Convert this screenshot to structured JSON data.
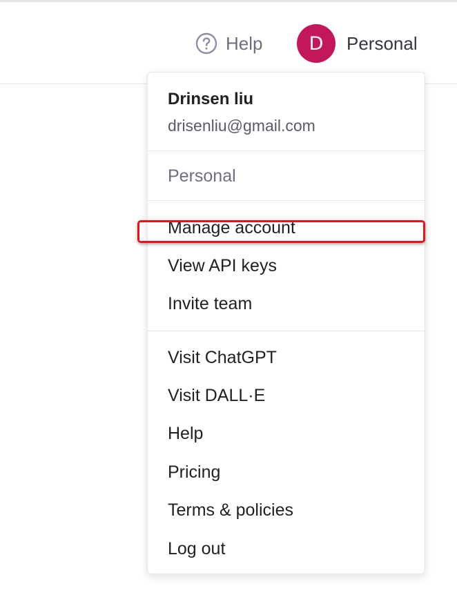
{
  "header": {
    "help_label": "Help",
    "help_icon": "help-circle-icon",
    "avatar_initial": "D",
    "account_label": "Personal"
  },
  "menu": {
    "user_name": "Drinsen liu",
    "user_email": "drisenliu@gmail.com",
    "section_title": "Personal",
    "items": [
      {
        "label": "Manage account"
      },
      {
        "label": "View API keys"
      },
      {
        "label": "Invite team"
      },
      {
        "label": "Visit ChatGPT"
      },
      {
        "label": "Visit DALL·E"
      },
      {
        "label": "Help"
      },
      {
        "label": "Pricing"
      },
      {
        "label": "Terms & policies"
      },
      {
        "label": "Log out"
      }
    ]
  },
  "colors": {
    "avatar_background": "#c2185b",
    "highlight_outline": "#ee0f18",
    "muted_text": "#6e6e80"
  }
}
